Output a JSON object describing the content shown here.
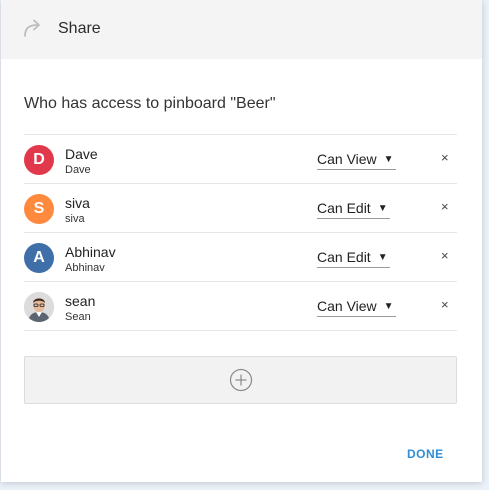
{
  "header": {
    "title": "Share",
    "icon": "share-arrow-icon"
  },
  "subtitle": "Who has access to  pinboard \"Beer\"",
  "users": [
    {
      "initial": "D",
      "name": "Dave",
      "sub": "Dave",
      "permission": "Can View",
      "color": "#e2384c"
    },
    {
      "initial": "S",
      "name": "siva",
      "sub": "siva",
      "permission": "Can Edit",
      "color": "#ff8a3d"
    },
    {
      "initial": "A",
      "name": "Abhinav",
      "sub": "Abhinav",
      "permission": "Can Edit",
      "color": "#3f6fa8"
    },
    {
      "initial": "",
      "name": "sean",
      "sub": "Sean",
      "permission": "Can View",
      "color": "#cccccc",
      "photo": true
    }
  ],
  "remove_symbol": "×",
  "done_label": "DONE",
  "colors": {
    "accent": "#2f8fd6",
    "header_bg": "#f4f4f4"
  }
}
